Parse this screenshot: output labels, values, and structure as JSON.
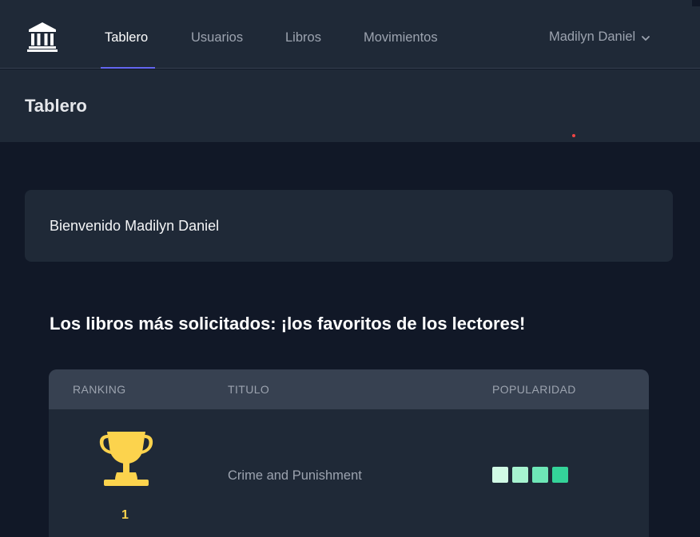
{
  "nav": {
    "items": [
      {
        "label": "Tablero",
        "active": true
      },
      {
        "label": "Usuarios",
        "active": false
      },
      {
        "label": "Libros",
        "active": false
      },
      {
        "label": "Movimientos",
        "active": false
      }
    ],
    "user_name": "Madilyn Daniel",
    "logo_icon": "bank-building-icon",
    "user_menu_icon": "chevron-down-icon"
  },
  "header": {
    "title": "Tablero"
  },
  "welcome": {
    "text": "Bienvenido Madilyn Daniel"
  },
  "section": {
    "title": "Los libros más solicitados: ¡los favoritos de los lectores!"
  },
  "table": {
    "headers": [
      "RANKING",
      "TITULO",
      "POPULARIDAD"
    ],
    "rows": [
      {
        "rank": "1",
        "rank_icon": "trophy-icon",
        "title": "Crime and Punishment",
        "popularity_level": 4,
        "popularity_max": 4
      }
    ]
  },
  "colors": {
    "accent": "#6366f1",
    "trophy": "#fcd34d",
    "popularity": [
      "#d1fae5",
      "#a7f3d0",
      "#6ee7b7",
      "#34d399"
    ]
  }
}
